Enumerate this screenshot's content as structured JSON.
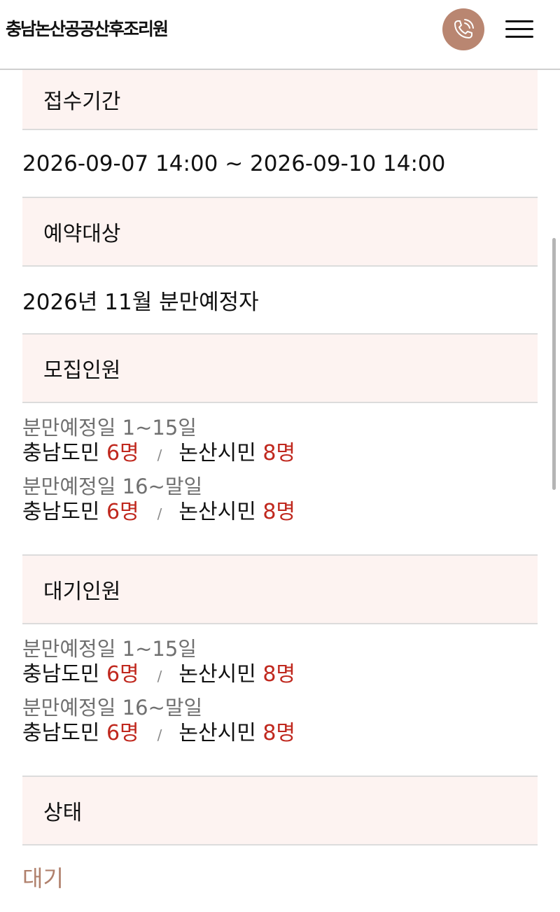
{
  "header": {
    "logo_text": "충남논산공공산후조리원",
    "call_icon": "phone-icon",
    "menu_icon": "hamburger-menu-icon",
    "accent_color": "#b98671"
  },
  "sections": {
    "period": {
      "title": "접수기간",
      "value": "2026-09-07 14:00 ~ 2026-09-10 14:00"
    },
    "target": {
      "title": "예약대상",
      "value": "2026년 11월 분만예정자"
    },
    "recruit": {
      "title": "모집인원",
      "groups": [
        {
          "label": "분만예정일 1~15일",
          "province_label": "충남도민",
          "province_count": "6명",
          "separator": "/",
          "city_label": "논산시민",
          "city_count": "8명"
        },
        {
          "label": "분만예정일 16~말일",
          "province_label": "충남도민",
          "province_count": "6명",
          "separator": "/",
          "city_label": "논산시민",
          "city_count": "8명"
        }
      ]
    },
    "waiting": {
      "title": "대기인원",
      "groups": [
        {
          "label": "분만예정일 1~15일",
          "province_label": "충남도민",
          "province_count": "6명",
          "separator": "/",
          "city_label": "논산시민",
          "city_count": "8명"
        },
        {
          "label": "분만예정일 16~말일",
          "province_label": "충남도민",
          "province_count": "6명",
          "separator": "/",
          "city_label": "논산시민",
          "city_count": "8명"
        }
      ]
    },
    "status": {
      "title": "상태",
      "value": "대기"
    }
  },
  "colors": {
    "count_red": "#c0281e",
    "status_brown": "#b0806c",
    "section_bg": "#fdf3f1"
  }
}
